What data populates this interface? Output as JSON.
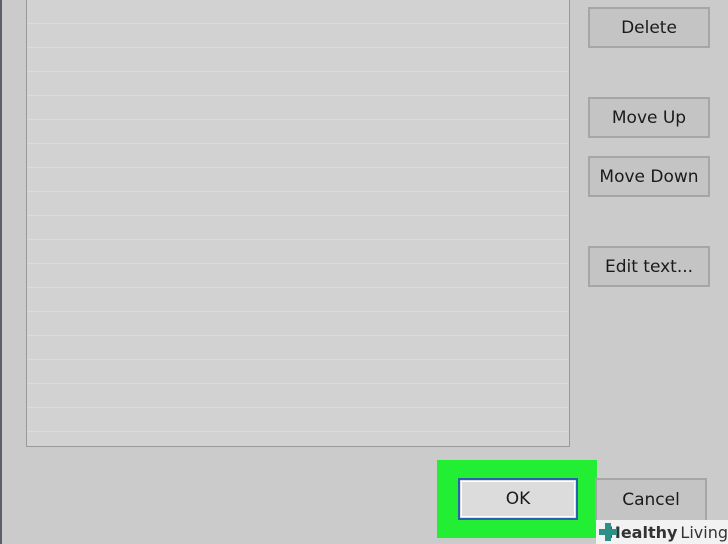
{
  "dialog": {
    "buttons": {
      "delete": "Delete",
      "move_up": "Move Up",
      "move_down": "Move Down",
      "edit_text": "Edit text...",
      "ok": "OK",
      "cancel": "Cancel"
    },
    "list": {
      "rows": 18
    }
  },
  "watermark": {
    "bold": "Healthy",
    "light": "Living",
    "icon": "plus-cross-icon"
  },
  "colors": {
    "ok_highlight": "#22ee33",
    "ok_focus_border": "#2b5fb0",
    "watermark_icon": "#2e8f86"
  }
}
